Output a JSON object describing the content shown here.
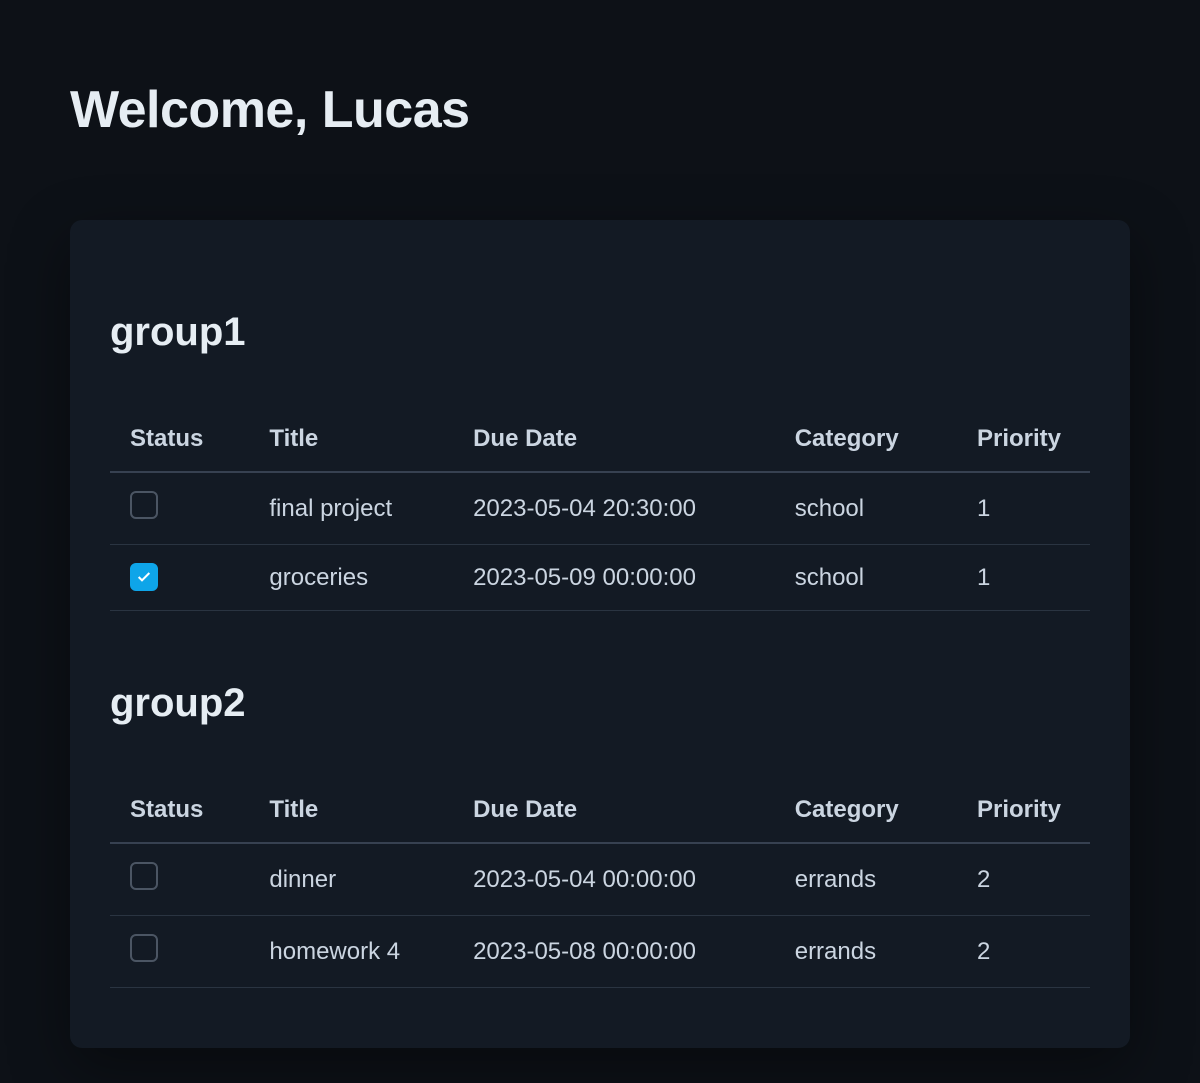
{
  "header": {
    "welcome": "Welcome, Lucas"
  },
  "columns": {
    "status": "Status",
    "title": "Title",
    "due_date": "Due Date",
    "category": "Category",
    "priority": "Priority"
  },
  "groups": [
    {
      "name": "group1",
      "rows": [
        {
          "status": false,
          "title": "final project",
          "due_date": "2023-05-04 20:30:00",
          "category": "school",
          "priority": "1"
        },
        {
          "status": true,
          "title": "groceries",
          "due_date": "2023-05-09 00:00:00",
          "category": "school",
          "priority": "1"
        }
      ]
    },
    {
      "name": "group2",
      "rows": [
        {
          "status": false,
          "title": "dinner",
          "due_date": "2023-05-04 00:00:00",
          "category": "errands",
          "priority": "2"
        },
        {
          "status": false,
          "title": "homework 4",
          "due_date": "2023-05-08 00:00:00",
          "category": "errands",
          "priority": "2"
        }
      ]
    }
  ]
}
